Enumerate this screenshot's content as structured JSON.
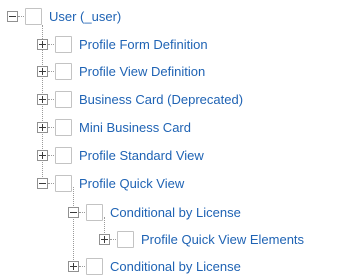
{
  "tree": {
    "root": {
      "label": "User (_user)",
      "state": "expanded"
    },
    "items": [
      {
        "label": "Profile Form Definition",
        "state": "collapsed"
      },
      {
        "label": "Profile View Definition",
        "state": "collapsed"
      },
      {
        "label": "Business Card (Deprecated)",
        "state": "collapsed"
      },
      {
        "label": "Mini Business Card",
        "state": "collapsed"
      },
      {
        "label": "Profile Standard View",
        "state": "collapsed"
      },
      {
        "label": "Profile Quick View",
        "state": "expanded",
        "children": [
          {
            "label": "Conditional by License",
            "state": "expanded",
            "children": [
              {
                "label": "Profile Quick View Elements",
                "state": "collapsed"
              }
            ]
          },
          {
            "label": "Conditional by License",
            "state": "collapsed"
          }
        ]
      }
    ]
  },
  "colors": {
    "link": "#1f63b4",
    "connector": "#9a9a9a",
    "node_border": "#c3c3c3"
  }
}
